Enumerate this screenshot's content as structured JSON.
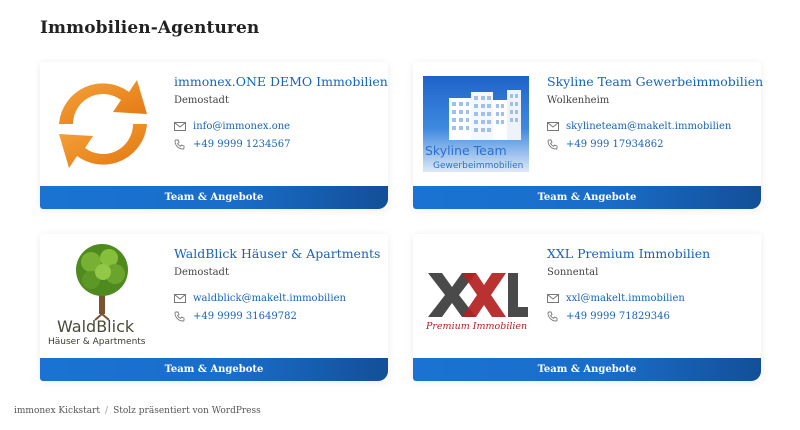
{
  "page": {
    "title": "Immobilien-Agenturen"
  },
  "agencies": [
    {
      "name": "immonex.ONE DEMO Immobilien",
      "city": "Demostadt",
      "email": "info@immonex.one",
      "phone": "+49 9999 1234567",
      "button": "Team & Angebote",
      "logo": "orange-sync-arrows-icon"
    },
    {
      "name": "Skyline Team Gewerbeimmobilien",
      "city": "Wolkenheim",
      "email": "skylineteam@makelt.immobilien",
      "phone": "+49 999 17934862",
      "button": "Team & Angebote",
      "logo_text1": "Skyline Team",
      "logo_text2": "Gewerbeimmobilien"
    },
    {
      "name": "WaldBlick Häuser & Apartments",
      "city": "Demostadt",
      "email": "waldblick@makelt.immobilien",
      "phone": "+49 9999 31649782",
      "button": "Team & Angebote",
      "logo_text1": "WaldBlick",
      "logo_text2": "Häuser & Apartments"
    },
    {
      "name": "XXL Premium Immobilien",
      "city": "Sonnental",
      "email": "xxl@makelt.immobilien",
      "phone": "+49 9999 71829346",
      "button": "Team & Angebote",
      "logo_text1": "Premium Immobilien"
    }
  ],
  "footer": {
    "site": "immonex Kickstart",
    "separator": "/",
    "credit": "Stolz präsentiert von WordPress"
  },
  "colors": {
    "link": "#1863b8",
    "button_start": "#1a73d2",
    "button_end": "#134f98",
    "logo_orange": "#f08a1c",
    "xxl_red": "#b3201f"
  }
}
